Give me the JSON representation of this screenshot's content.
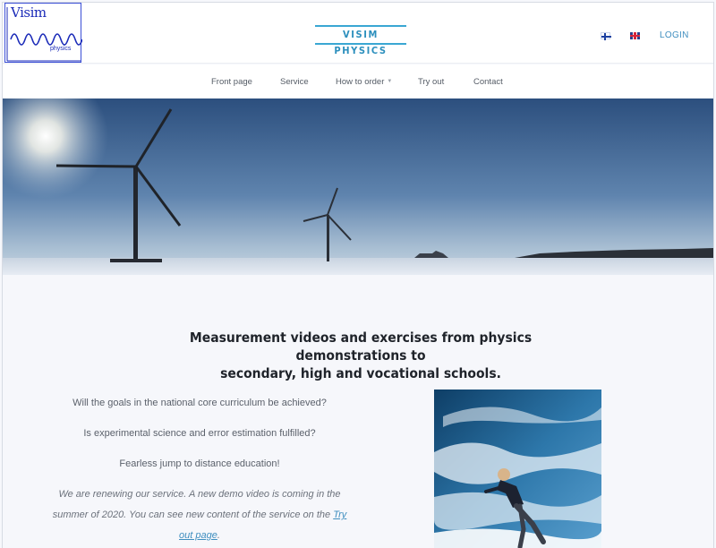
{
  "header": {
    "logo_text": "Visim",
    "logo_subtext": "physics",
    "brand": "VISIM PHYSICS",
    "login_label": "LOGIN",
    "languages": [
      "fi-flag-icon",
      "uk-flag-icon"
    ]
  },
  "nav": {
    "items": [
      {
        "label": "Front page"
      },
      {
        "label": "Service"
      },
      {
        "label": "How to order",
        "has_dropdown": true
      },
      {
        "label": "Try out"
      },
      {
        "label": "Contact"
      }
    ]
  },
  "main": {
    "headline_line1": "Measurement videos and exercises from physics demonstrations to",
    "headline_line2": "secondary, high and vocational schools.",
    "paragraphs": [
      "Will the goals in the national core curriculum be achieved?",
      "Is experimental science and error estimation fulfilled?",
      "Fearless jump to distance education!"
    ],
    "notice_text": "We are renewing our service. A new demo video is coming in the summer of 2020. You can see new content of the service on the",
    "notice_link": "Try out page",
    "notice_end": "."
  },
  "colors": {
    "accent": "#3aa7d3",
    "link": "#3f8ebf",
    "background": "#f6f7fb"
  }
}
